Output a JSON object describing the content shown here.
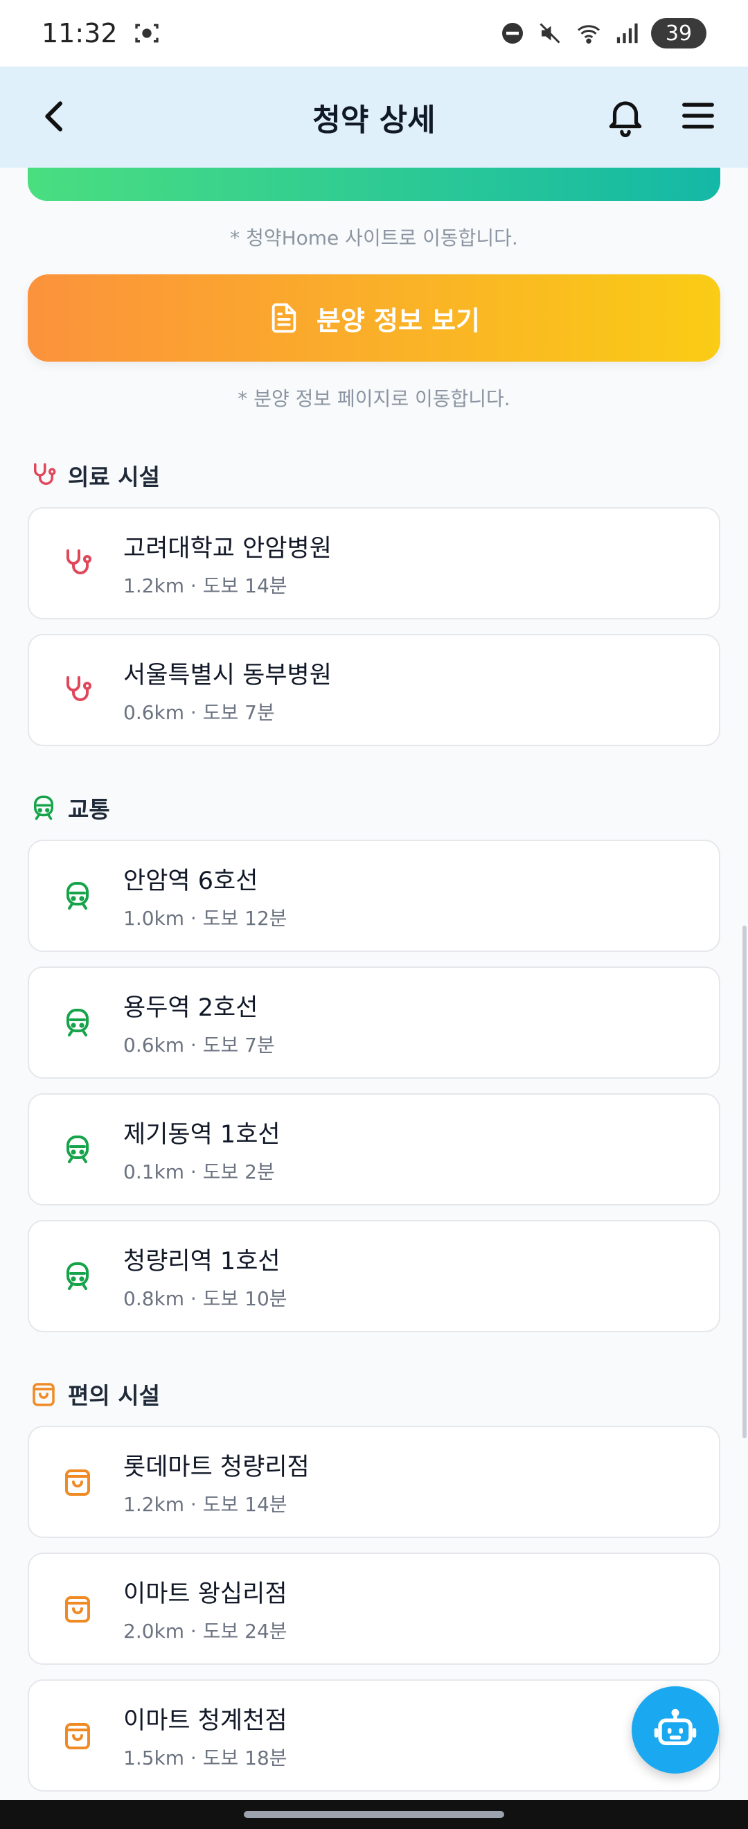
{
  "status_bar": {
    "time": "11:32",
    "battery": "39"
  },
  "header": {
    "title": "청약 상세"
  },
  "buttons": {
    "cheongyak_note": "* 청약Home 사이트로 이동합니다.",
    "bunyang_label": "분양 정보 보기",
    "bunyang_note": "* 분양 정보 페이지로 이동합니다."
  },
  "sections": {
    "medical": {
      "title": "의료 시설",
      "items": [
        {
          "name": "고려대학교 안암병원",
          "meta": "1.2km · 도보 14분"
        },
        {
          "name": "서울특별시 동부병원",
          "meta": "0.6km · 도보 7분"
        }
      ]
    },
    "transit": {
      "title": "교통",
      "items": [
        {
          "name": "안암역 6호선",
          "meta": "1.0km · 도보 12분"
        },
        {
          "name": "용두역 2호선",
          "meta": "0.6km · 도보 7분"
        },
        {
          "name": "제기동역 1호선",
          "meta": "0.1km · 도보 2분"
        },
        {
          "name": "청량리역 1호선",
          "meta": "0.8km · 도보 10분"
        }
      ]
    },
    "convenience": {
      "title": "편의 시설",
      "items": [
        {
          "name": "롯데마트 청량리점",
          "meta": "1.2km · 도보 14분"
        },
        {
          "name": "이마트 왕십리점",
          "meta": "2.0km · 도보 24분"
        },
        {
          "name": "이마트 청계천점",
          "meta": "1.5km · 도보 18분"
        }
      ]
    }
  },
  "colors": {
    "medical": "#e0475b",
    "transit": "#16a34a",
    "convenience": "#f08a24",
    "fab": "#1aa9f0"
  },
  "icons": {
    "medical": "stethoscope-icon",
    "transit": "train-icon",
    "convenience": "shopping-bag-icon",
    "fab": "robot-icon"
  }
}
